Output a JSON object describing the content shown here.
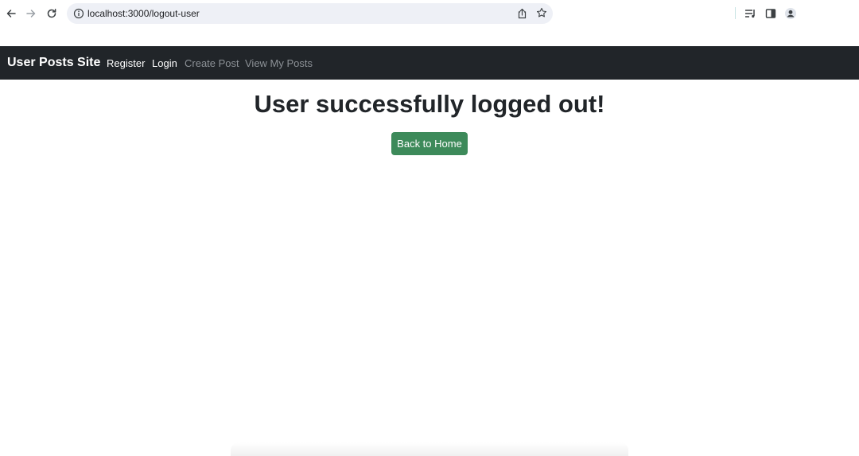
{
  "browser": {
    "url": "localhost:3000/logout-user",
    "icons": {
      "back": "arrow-left-icon",
      "forward": "arrow-right-icon",
      "reload": "reload-icon",
      "site_info": "info-icon",
      "share": "share-icon",
      "bookmark": "star-icon",
      "media": "media-controls-icon",
      "side_panel": "side-panel-icon",
      "profile": "profile-avatar-icon"
    }
  },
  "navbar": {
    "brand": "User Posts Site",
    "links": [
      {
        "label": "Register",
        "state": "active"
      },
      {
        "label": "Login",
        "state": "active"
      },
      {
        "label": "Create Post",
        "state": "muted"
      },
      {
        "label": "View My Posts",
        "state": "muted"
      }
    ],
    "background_color": "#212529"
  },
  "main": {
    "heading": "User successfully logged out!",
    "home_button_label": "Back to Home",
    "button_color": "#3d8a5a"
  }
}
